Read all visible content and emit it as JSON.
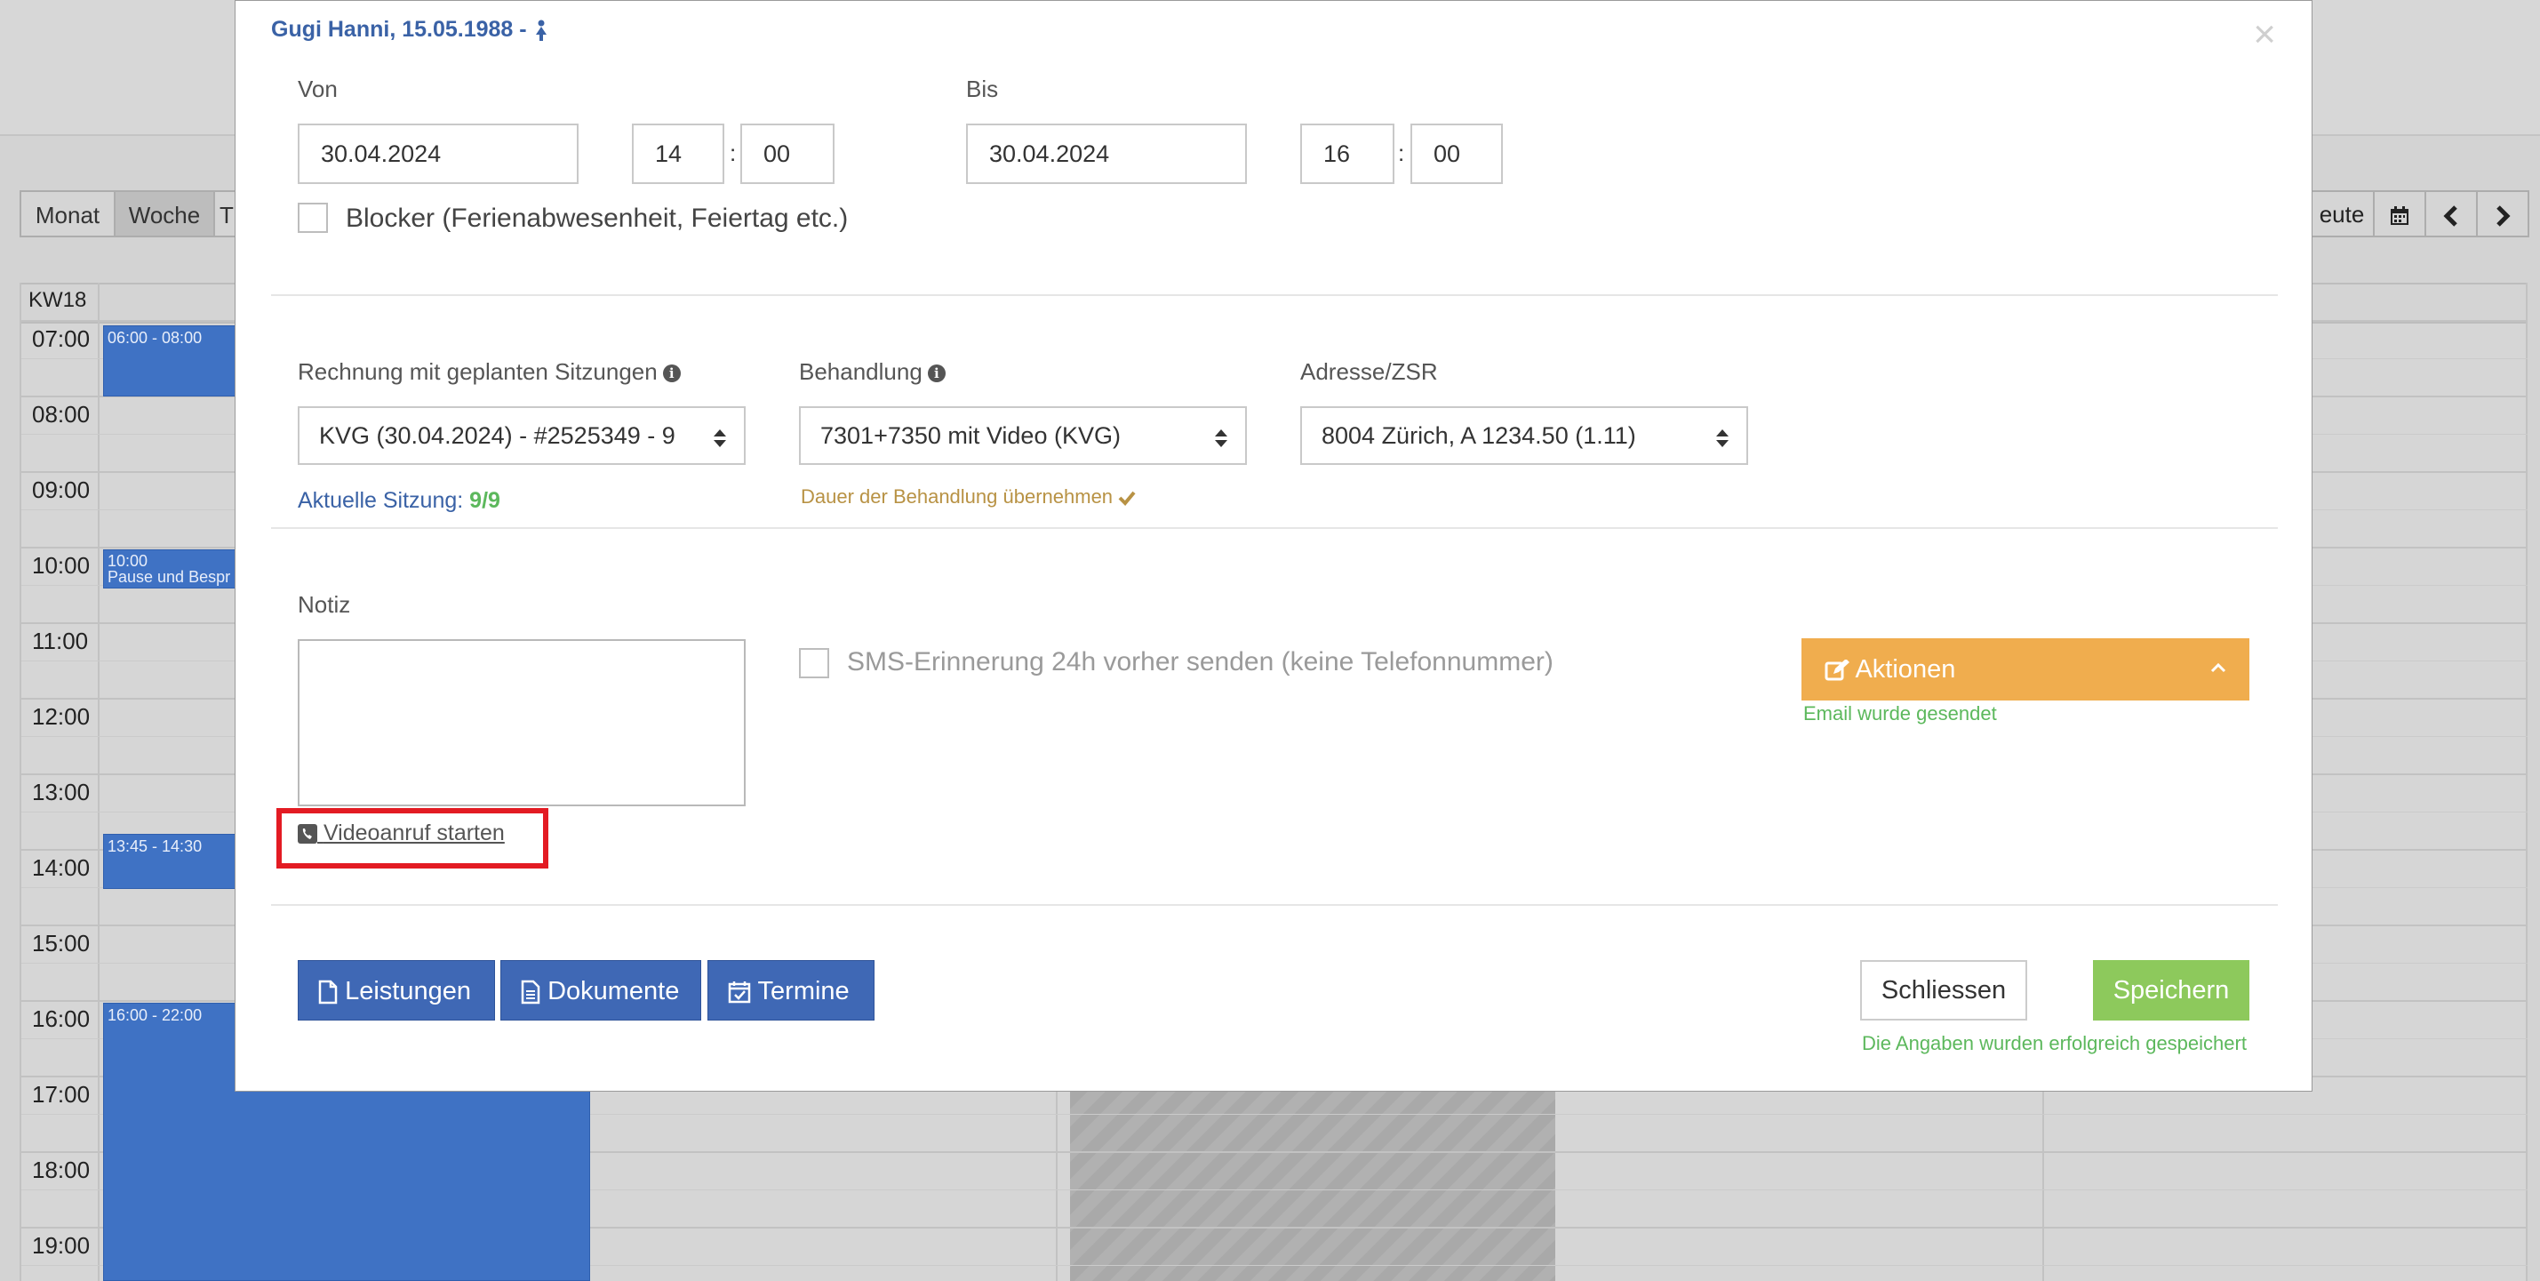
{
  "calendar": {
    "view_buttons": [
      "Monat",
      "Woche",
      "T"
    ],
    "today_partial": "eute",
    "week_label": "KW18",
    "times": [
      "07:00",
      "08:00",
      "09:00",
      "10:00",
      "11:00",
      "12:00",
      "13:00",
      "14:00",
      "15:00",
      "16:00",
      "17:00",
      "18:00",
      "19:00"
    ],
    "events": [
      {
        "label": "06:00 - 08:00"
      },
      {
        "label": "10:00",
        "sub": "Pause und Bespr"
      },
      {
        "label": "13:45 - 14:30"
      },
      {
        "label": "16:00 - 22:00"
      }
    ]
  },
  "modal": {
    "title": "Gugi Hanni, 15.05.1988 -",
    "close": "×",
    "von_label": "Von",
    "bis_label": "Bis",
    "von_date": "30.04.2024",
    "von_hour": "14",
    "von_min": "00",
    "bis_date": "30.04.2024",
    "bis_hour": "16",
    "bis_min": "00",
    "time_sep": ":",
    "blocker_label": "Blocker (Ferienabwesenheit, Feiertag etc.)",
    "rechnung_label": "Rechnung mit geplanten Sitzungen",
    "rechnung_value": "KVG (30.04.2024) - #2525349 - 9",
    "behandlung_label": "Behandlung",
    "behandlung_value": "7301+7350 mit Video (KVG)",
    "adresse_label": "Adresse/ZSR",
    "adresse_value": "8004 Zürich, A 1234.50 (1.11)",
    "aktuelle_label": "Aktuelle Sitzung:",
    "aktuelle_value": "9/9",
    "dauer_text": "Dauer der Behandlung übernehmen",
    "notiz_label": "Notiz",
    "notiz_value": "",
    "video_link": "Videoanruf starten",
    "sms_label": "SMS-Erinnerung 24h vorher senden (keine Telefonnummer)",
    "aktionen_label": "Aktionen",
    "email_status": "Email wurde gesendet",
    "btn_leistungen": "Leistungen",
    "btn_dokumente": "Dokumente",
    "btn_termine": "Termine",
    "btn_schliessen": "Schliessen",
    "btn_speichern": "Speichern",
    "save_status": "Die Angaben wurden erfolgreich gespeichert"
  },
  "colors": {
    "primary": "#3f68b5",
    "warning": "#f0ad4e",
    "success": "#8dc95c",
    "highlight": "#e31b23"
  }
}
